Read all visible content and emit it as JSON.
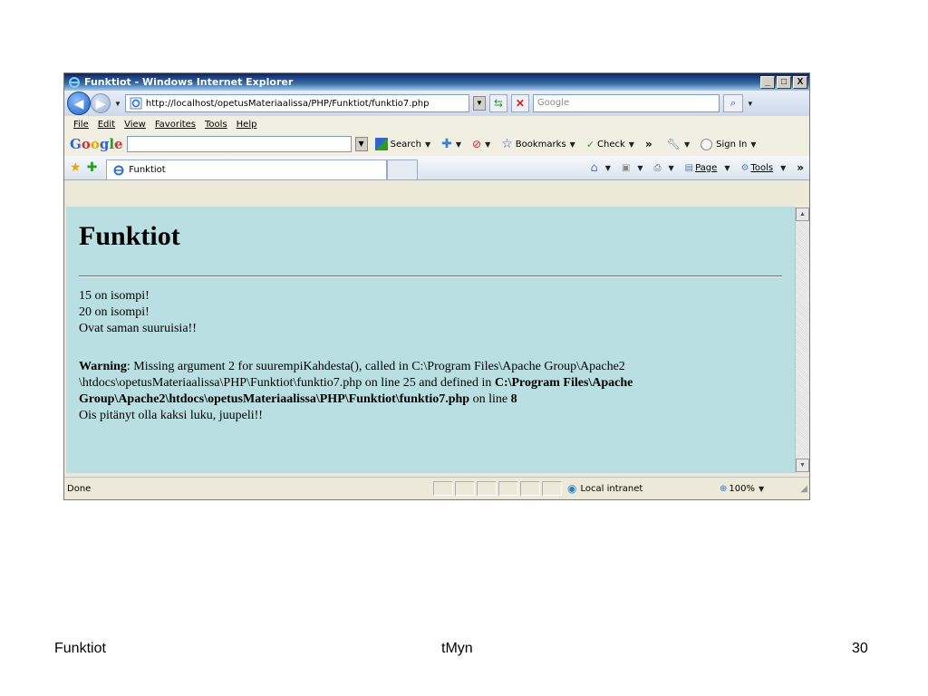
{
  "window": {
    "title": "Funktiot - Windows Internet Explorer",
    "minimize": "_",
    "maximize": "□",
    "close": "X"
  },
  "address_bar": {
    "url": "http://localhost/opetusMateriaalissa/PHP/Funktiot/funktio7.php",
    "search_placeholder": "Google"
  },
  "menu": [
    "File",
    "Edit",
    "View",
    "Favorites",
    "Tools",
    "Help"
  ],
  "google_toolbar": {
    "logo": "Google",
    "search": "Search",
    "bookmarks": "Bookmarks",
    "check": "Check",
    "more": "»",
    "sign_in": "Sign In"
  },
  "tab": {
    "title": "Funktiot"
  },
  "command_bar": {
    "page": "Page",
    "tools": "Tools",
    "more": "»"
  },
  "content": {
    "heading": "Funktiot",
    "lines": [
      "15 on isompi!",
      "20 on isompi!",
      "Ovat saman suuruisia!!"
    ],
    "warning_label": "Warning",
    "warning_text_1": ": Missing argument 2 for suurempiKahdesta(), called in C:\\Program Files\\Apache Group\\Apache2 \\htdocs\\opetusMateriaalissa\\PHP\\Funktiot\\funktio7.php on line 25 and defined in ",
    "warning_path": "C:\\Program Files\\Apache Group\\Apache2\\htdocs\\opetusMateriaalissa\\PHP\\Funktiot\\funktio7.php",
    "warning_text_2": " on line ",
    "warning_line": "8",
    "last_line": "Ois pitänyt olla kaksi luku, juupeli!!"
  },
  "status_bar": {
    "status": "Done",
    "zone": "Local intranet",
    "zoom": "100%"
  },
  "slide_footer": {
    "left": "Funktiot",
    "center": "tMyn",
    "page_number": "30"
  }
}
